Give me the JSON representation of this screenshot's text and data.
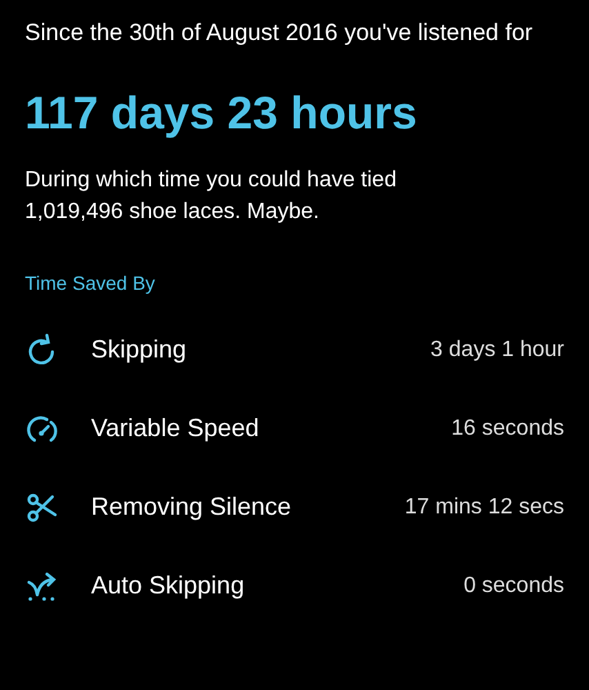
{
  "intro": "Since the 30th of August 2016 you've listened for",
  "total": "117 days 23 hours",
  "fun_fact": "During which time you could have tied 1,019,496 shoe laces. Maybe.",
  "section_title": "Time Saved By",
  "rows": [
    {
      "kind": "skip",
      "label": "Skipping",
      "value": "3 days 1 hour"
    },
    {
      "kind": "speed",
      "label": "Variable Speed",
      "value": "16 seconds"
    },
    {
      "kind": "silence",
      "label": "Removing Silence",
      "value": "17 mins 12 secs"
    },
    {
      "kind": "autoskip",
      "label": "Auto Skipping",
      "value": "0 seconds"
    }
  ]
}
